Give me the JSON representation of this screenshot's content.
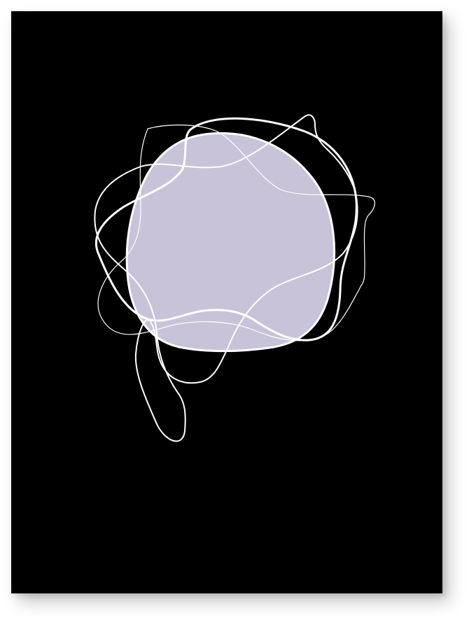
{
  "artwork": {
    "background_color": "#000000",
    "blob_fill_color": "#c8c3d8",
    "line_color": "#ffffff",
    "page_color": "#ffffff"
  }
}
